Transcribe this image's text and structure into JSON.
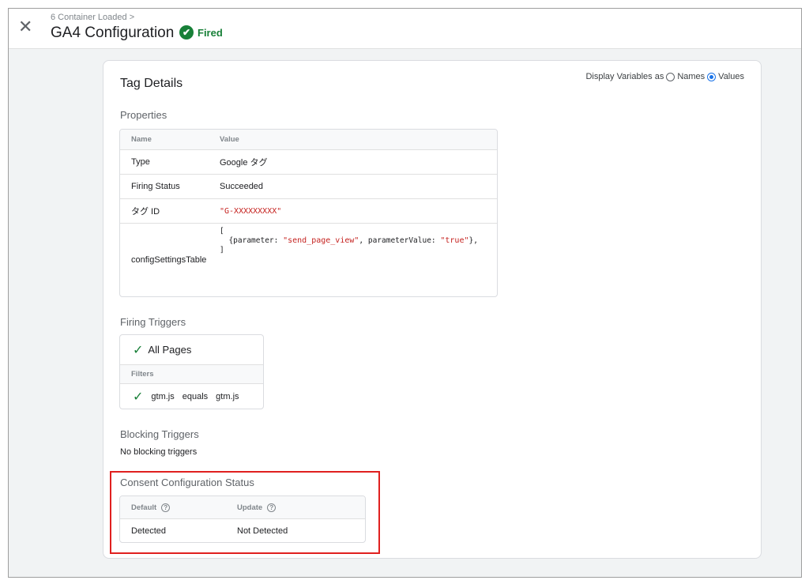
{
  "header": {
    "breadcrumb": "6 Container Loaded >",
    "title": "GA4 Configuration",
    "status": "Fired",
    "close_icon": "close-icon",
    "status_color": "#188038"
  },
  "card": {
    "title": "Tag Details",
    "display_vars_label": "Display Variables as",
    "names_label": "Names",
    "values_label": "Values",
    "selected": "Values"
  },
  "properties": {
    "title": "Properties",
    "col_name": "Name",
    "col_value": "Value",
    "rows": [
      {
        "name": "Type",
        "value": "Google タグ"
      },
      {
        "name": "Firing Status",
        "value": "Succeeded"
      },
      {
        "name": "タグ ID",
        "value": "\"G-XXXXXXXXX\""
      }
    ],
    "config": {
      "name": "configSettingsTable",
      "open": "[",
      "p1": "  {parameter: ",
      "v1": "\"send_page_view\"",
      "p2": ", parameterValue: ",
      "v2": "\"true\"",
      "p3": "},",
      "close": "]"
    }
  },
  "firing": {
    "title": "Firing Triggers",
    "trigger": "All Pages",
    "filters_label": "Filters",
    "filter": {
      "var": "gtm.js",
      "op": "equals",
      "val": "gtm.js"
    }
  },
  "blocking": {
    "title": "Blocking Triggers",
    "text": "No blocking triggers"
  },
  "consent": {
    "title": "Consent Configuration Status",
    "col_default": "Default",
    "col_update": "Update",
    "default_value": "Detected",
    "update_value": "Not Detected",
    "highlight_color": "#e0201f"
  }
}
